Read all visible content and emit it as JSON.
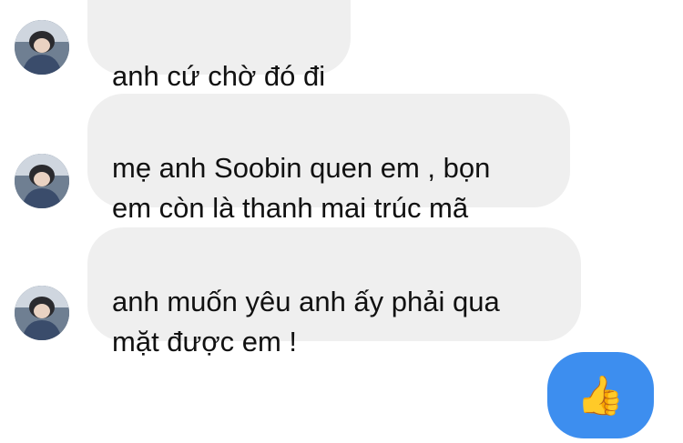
{
  "messages": [
    {
      "text": "anh cứ chờ đó đi"
    },
    {
      "text": "mẹ anh Soobin quen em , bọn\nem còn là thanh mai trúc mã"
    },
    {
      "text": "anh muốn yêu anh ấy phải qua\nmặt được em !"
    }
  ],
  "reaction": {
    "glyph": "👍",
    "icon": "thumbs-up-icon"
  },
  "colors": {
    "incoming_bubble": "#efefef",
    "outgoing_bubble": "#3d8eef",
    "text": "#111111"
  }
}
